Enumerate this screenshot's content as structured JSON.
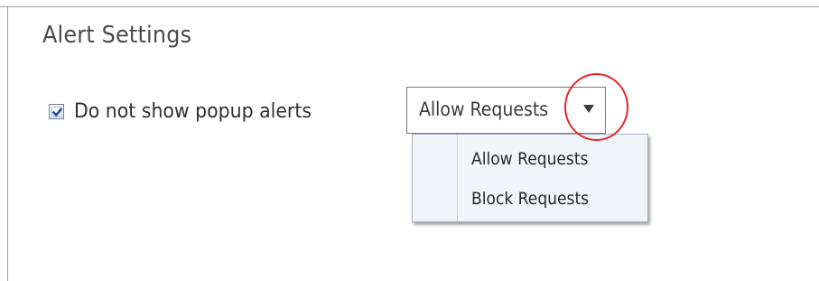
{
  "section": {
    "title": "Alert Settings"
  },
  "popup_alerts": {
    "label": "Do not show popup alerts",
    "checked": true
  },
  "request_select": {
    "selected": "Allow Requests",
    "options": [
      "Allow Requests",
      "Block Requests"
    ],
    "expanded": true
  },
  "icons": {
    "dropdown_arrow": "chevron-down-icon",
    "checkmark": "checkmark-icon"
  },
  "colors": {
    "highlight": "#e8262b",
    "menu_background": "#f1f4f9",
    "checkbox_border": "#6d7fa0"
  }
}
